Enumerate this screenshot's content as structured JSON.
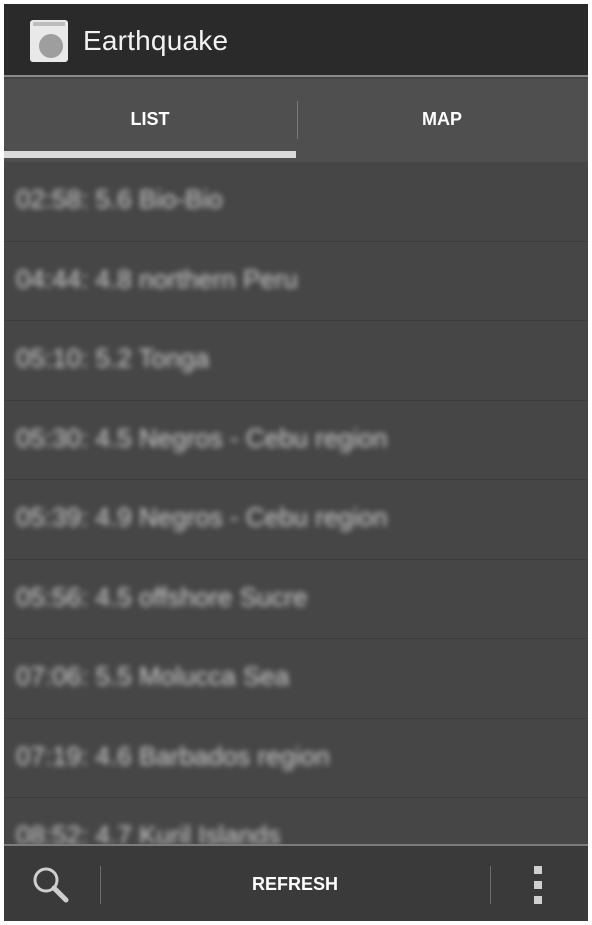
{
  "app": {
    "title": "Earthquake",
    "icon": "earthquake-app-icon"
  },
  "tabs": [
    {
      "label": "LIST",
      "selected": true
    },
    {
      "label": "MAP",
      "selected": false
    }
  ],
  "quakes": [
    {
      "label": "02:58: 5.6 Bio-Bio"
    },
    {
      "label": "04:44: 4.8 northern Peru"
    },
    {
      "label": "05:10: 5.2 Tonga"
    },
    {
      "label": "05:30: 4.5 Negros - Cebu region"
    },
    {
      "label": "05:39: 4.9 Negros - Cebu region"
    },
    {
      "label": "05:56: 4.5 offshore Sucre"
    },
    {
      "label": "07:06: 5.5 Molucca Sea"
    },
    {
      "label": "07:19: 4.6 Barbados region"
    },
    {
      "label": "08:52: 4.7 Kuril Islands"
    }
  ],
  "bottombar": {
    "search_icon": "search-icon",
    "refresh_label": "REFRESH",
    "overflow_icon": "overflow-menu-icon"
  },
  "colors": {
    "actionbar": "#2a2a2a",
    "list_background": "#464646",
    "tab_indicator": "#d9d9d9"
  }
}
